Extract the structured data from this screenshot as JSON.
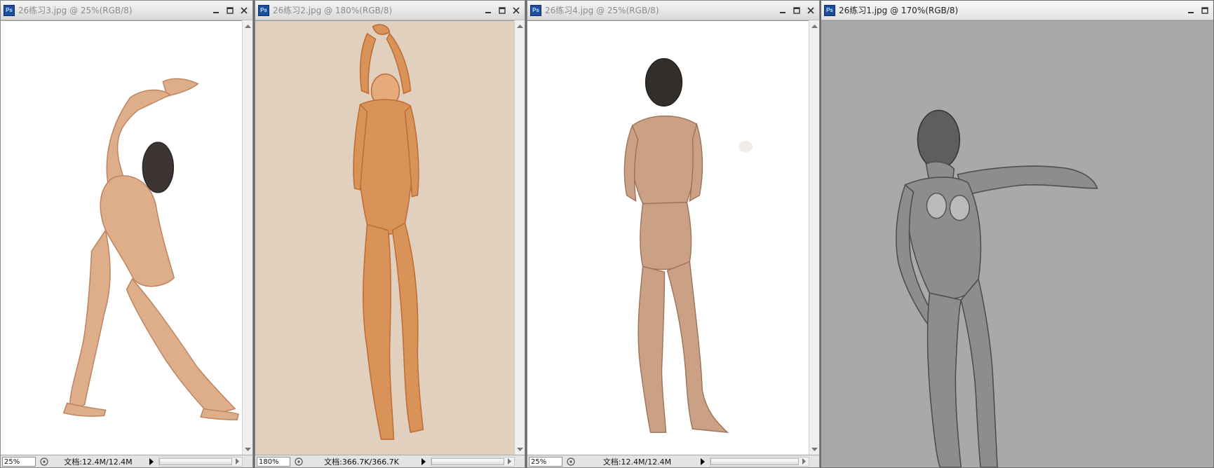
{
  "app_icon_label": "Ps",
  "icons": {
    "app": "photoshop-icon",
    "minimize": "minimize-icon",
    "maximize": "maximize-icon",
    "close": "close-icon",
    "status_menu": "status-menu-icon",
    "status_next": "play-arrow-icon"
  },
  "windows": [
    {
      "title": "26练习3.jpg @ 25%(RGB/8)",
      "zoom": "25%",
      "doc_info": "文档:12.4M/12.4M",
      "active": false,
      "canvas_background": "#ffffff",
      "has_vertical_scrollbar": true,
      "image_description_icon": "figure-drawing-icon"
    },
    {
      "title": "26练习2.jpg @ 180%(RGB/8)",
      "zoom": "180%",
      "doc_info": "文档:366.7K/366.7K",
      "active": false,
      "canvas_background": "#e2d0bf",
      "has_vertical_scrollbar": true,
      "image_description_icon": "figure-drawing-icon"
    },
    {
      "title": "26练习4.jpg @ 25%(RGB/8)",
      "zoom": "25%",
      "doc_info": "文档:12.4M/12.4M",
      "active": false,
      "canvas_background": "#ffffff",
      "has_vertical_scrollbar": true,
      "image_description_icon": "figure-drawing-icon"
    },
    {
      "title": "26练习1.jpg @ 170%(RGB/8)",
      "zoom": "170%",
      "doc_info": "",
      "active": true,
      "canvas_background": "#a9a9a9",
      "has_vertical_scrollbar": false,
      "image_description_icon": "figure-drawing-icon"
    }
  ]
}
